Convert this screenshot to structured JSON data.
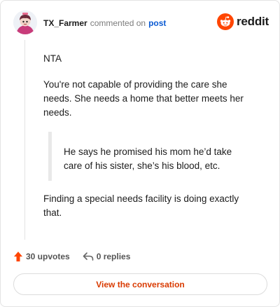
{
  "header": {
    "username": "TX_Farmer",
    "action_text": "commented on",
    "post_link": "post",
    "logo_text": "reddit"
  },
  "comment": {
    "paragraphs": [
      "NTA",
      "You're not capable of providing the care she needs. She needs a home that better meets her needs.",
      "Finding a special needs facility is doing exactly that."
    ],
    "quote": "He says he promised his mom he’d take care of his sister, she’s his blood, etc."
  },
  "actions": {
    "upvotes": "30 upvotes",
    "replies": "0 replies"
  },
  "cta": {
    "label": "View the conversation"
  },
  "colors": {
    "accent": "#d93a00",
    "link": "#0b5bd3",
    "upvote": "#ff4500",
    "reddit_orange": "#ff4500"
  },
  "icons": [
    "user-avatar",
    "reddit-snoo-icon",
    "upvote-arrow-icon",
    "reply-arrow-icon"
  ]
}
